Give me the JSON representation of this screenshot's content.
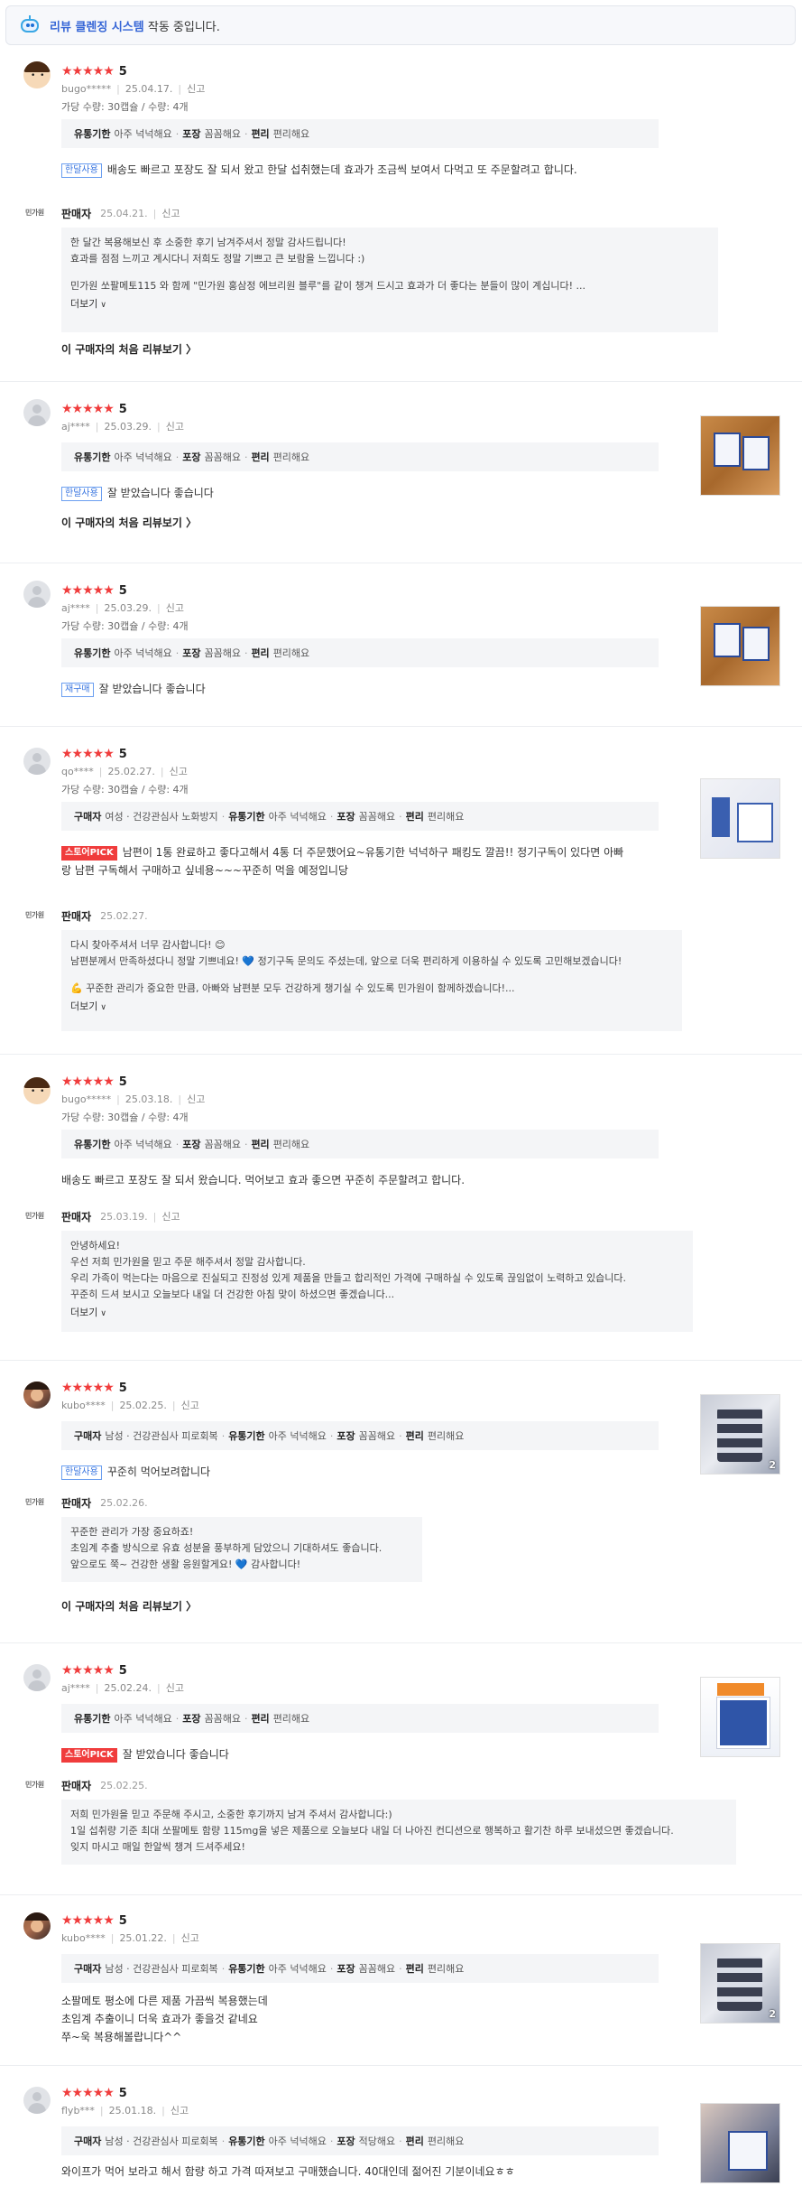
{
  "banner": {
    "highlight": "리뷰 클렌징 시스템",
    "rest": "작동 중입니다.",
    "icon": "robot-icon"
  },
  "common": {
    "report": "신고",
    "seller": "판매자",
    "more": "더보기",
    "first_review": "이 구매자의 처음 리뷰보기 〉",
    "stars": "★★★★★",
    "seller_logo": "민가원"
  },
  "reviews": [
    {
      "score": "5",
      "user": "bugo*****",
      "date": "25.04.17.",
      "option": "가당 수량: 30캡슐 / 수량: 4개",
      "attrs": {
        "k1": "유통기한",
        "v1": "아주 넉넉해요",
        "k2": "포장",
        "v2": "꼼꼼해요",
        "k3": "편리",
        "v3": "편리해요"
      },
      "tag": "한달사용",
      "text": [
        "배송도 빠르고 포장도 잘 되서 왔고 한달 섭취했는데 효과가 조금씩 보여서 다먹고 또 주문할려고 합니다."
      ],
      "seller": {
        "date": "25.04.21.",
        "lines": [
          "한 달간 복용해보신 후 소중한 후기 남겨주셔서 정말 감사드립니다!",
          "효과를 점점 느끼고 계시다니 저희도 정말 기쁘고 큰 보람을 느낍니다 :)",
          "",
          "민가원 쏘팔메토115 와 함께 \"민가원 홍삼정 에브리원 블루\"를 같이 챙겨 드시고 효과가 더 좋다는 분들이 많이 계십니다! ..."
        ]
      }
    },
    {
      "score": "5",
      "user": "aj****",
      "date": "25.03.29.",
      "attrs": {
        "k1": "유통기한",
        "v1": "아주 넉넉해요",
        "k2": "포장",
        "v2": "꼼꼼해요",
        "k3": "편리",
        "v3": "편리해요"
      },
      "tag": "한달사용",
      "text": [
        "잘 받았습니다 좋습니다"
      ]
    },
    {
      "score": "5",
      "user": "aj****",
      "date": "25.03.29.",
      "option": "가당 수량: 30캡슐 / 수량: 4개",
      "attrs": {
        "k1": "유통기한",
        "v1": "아주 넉넉해요",
        "k2": "포장",
        "v2": "꼼꼼해요",
        "k3": "편리",
        "v3": "편리해요"
      },
      "tag": "재구매",
      "text": [
        "잘 받았습니다 좋습니다"
      ]
    },
    {
      "score": "5",
      "user": "qo****",
      "date": "25.02.27.",
      "option": "가당 수량: 30캡슐 / 수량: 4개",
      "attrs": {
        "k0": "구매자",
        "v0": "여성 · 건강관심사 노화방지",
        "k1": "유통기한",
        "v1": "아주 넉넉해요",
        "k2": "포장",
        "v2": "꼼꼼해요",
        "k3": "편리",
        "v3": "편리해요"
      },
      "tag": "스토어PICK",
      "text": [
        "남편이 1통 완료하고 좋다고해서 4통 더 주문했어요~유통기한 넉넉하구 패킹도 깔끔!! 정기구독이 있다면 아빠",
        "랑 남편 구독해서 구매하고 싶네용~~~꾸준히 먹을 예정입니당"
      ],
      "seller": {
        "date": "25.02.27.",
        "lines": [
          "다시 찾아주셔서 너무 감사합니다! 😊",
          "남편분께서 만족하셨다니 정말 기쁘네요! 💙 정기구독 문의도 주셨는데, 앞으로 더욱 편리하게 이용하실 수 있도록 고민해보겠습니다!",
          "",
          "💪 꾸준한 관리가 중요한 만큼, 아빠와 남편분 모두 건강하게 챙기실 수 있도록 민가원이 함께하겠습니다!..."
        ]
      }
    },
    {
      "score": "5",
      "user": "bugo*****",
      "date": "25.03.18.",
      "option": "가당 수량: 30캡슐 / 수량: 4개",
      "attrs": {
        "k1": "유통기한",
        "v1": "아주 넉넉해요",
        "k2": "포장",
        "v2": "꼼꼼해요",
        "k3": "편리",
        "v3": "편리해요"
      },
      "text": [
        "배송도 빠르고 포장도 잘 되서 왔습니다. 먹어보고 효과 좋으면 꾸준히 주문할려고 합니다."
      ],
      "seller": {
        "date": "25.03.19.",
        "lines": [
          "안녕하세요!",
          "우선 저희 민가원을 믿고 주문 해주셔서 정말 감사합니다.",
          "우리 가족이 먹는다는 마음으로 진실되고 진정성 있게 제품을 만들고 합리적인 가격에 구매하실 수 있도록 끊임없이 노력하고 있습니다.",
          "꾸준히 드셔 보시고 오늘보다 내일 더 건강한 아침 맞이 하셨으면 좋겠습니다..."
        ]
      }
    },
    {
      "score": "5",
      "user": "kubo****",
      "date": "25.02.25.",
      "attrs": {
        "k0": "구매자",
        "v0": "남성 · 건강관심사 피로회복",
        "k1": "유통기한",
        "v1": "아주 넉넉해요",
        "k2": "포장",
        "v2": "꼼꼼해요",
        "k3": "편리",
        "v3": "편리해요"
      },
      "tag": "한달사용",
      "text": [
        "꾸준히 먹어보려합니다"
      ],
      "photo_count": "2",
      "seller": {
        "date": "25.02.26.",
        "lines": [
          "꾸준한 관리가 가장 중요하죠!",
          "초임계 추출 방식으로 유효 성분을 풍부하게 담았으니 기대하셔도 좋습니다.",
          "앞으로도 쭉~ 건강한 생활 응원할게요! 💙 감사합니다!"
        ]
      }
    },
    {
      "score": "5",
      "user": "aj****",
      "date": "25.02.24.",
      "attrs": {
        "k1": "유통기한",
        "v1": "아주 넉넉해요",
        "k2": "포장",
        "v2": "꼼꼼해요",
        "k3": "편리",
        "v3": "편리해요"
      },
      "tag": "스토어PICK",
      "text": [
        "잘 받았습니다 좋습니다"
      ],
      "seller": {
        "date": "25.02.25.",
        "lines": [
          "저희 민가원을 믿고 주문해 주시고, 소중한 후기까지 남겨 주셔서 감사합니다:)",
          "1일 섭취량 기준 최대 쏘팔메토 함량 115mg을 넣은 제품으로 오늘보다 내일 더 나아진 컨디션으로 행복하고 활기찬 하루 보내셨으면 좋겠습니다.",
          "잊지 마시고 매일 한알씩 챙겨 드셔주세요!"
        ]
      }
    },
    {
      "score": "5",
      "user": "kubo****",
      "date": "25.01.22.",
      "attrs": {
        "k0": "구매자",
        "v0": "남성 · 건강관심사 피로회복",
        "k1": "유통기한",
        "v1": "아주 넉넉해요",
        "k2": "포장",
        "v2": "꼼꼼해요",
        "k3": "편리",
        "v3": "편리해요"
      },
      "text": [
        "소팔메토 평소에 다른 제품 가끔씩 복용했는데",
        "초임계 추출이니 더욱 효과가 좋을것 같네요",
        "쭈~욱 복용해볼랍니다^^"
      ],
      "photo_count": "2"
    },
    {
      "score": "5",
      "user": "flyb***",
      "date": "25.01.18.",
      "attrs": {
        "k0": "구매자",
        "v0": "남성 · 건강관심사 피로회복",
        "k1": "유통기한",
        "v1": "아주 넉넉해요",
        "k2": "포장",
        "v2": "적당해요",
        "k3": "편리",
        "v3": "편리해요"
      },
      "text": [
        "와이프가 먹어 보라고 해서 함량 하고 가격 따져보고 구매했습니다.  40대인데 젊어진 기분이네요ㅎㅎ"
      ]
    }
  ]
}
